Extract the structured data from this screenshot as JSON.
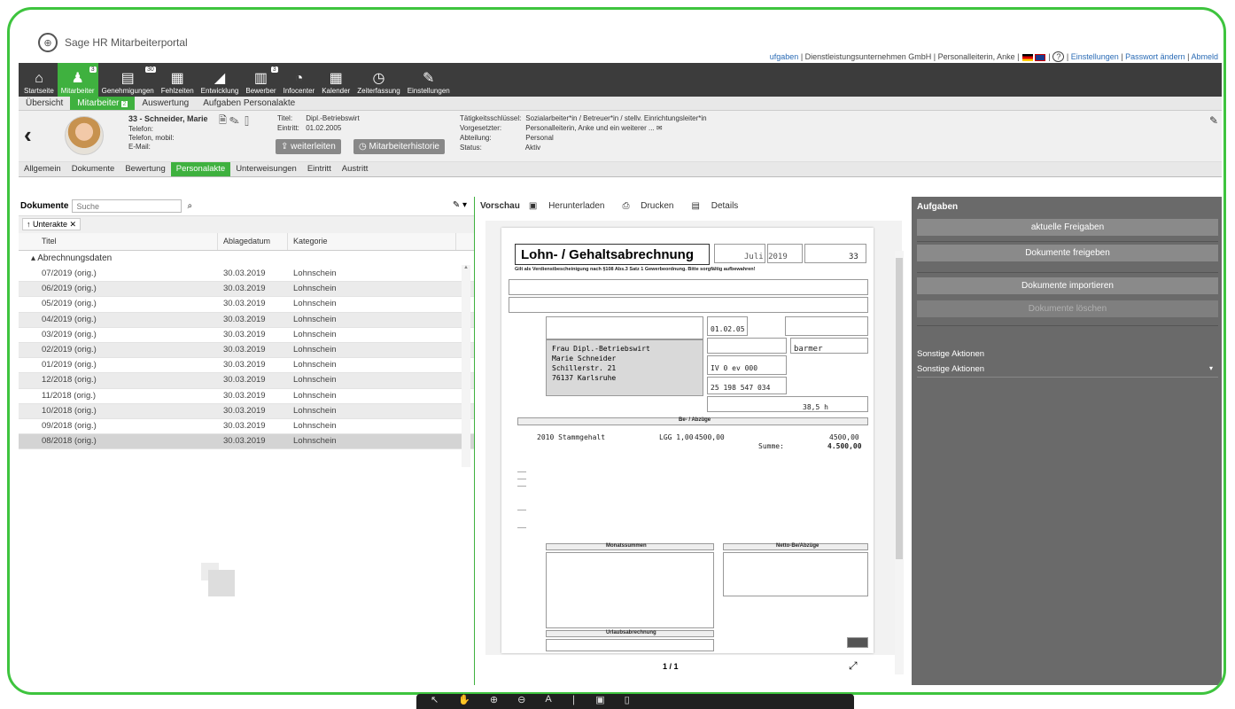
{
  "app": {
    "title": "Sage HR Mitarbeiterportal"
  },
  "toplinks": {
    "aufgaben": "ufgaben",
    "company": "Dienstleistungsunternehmen GmbH",
    "user": "Personalleiterin, Anke",
    "help": "?",
    "settings": "Einstellungen",
    "password": "Passwort ändern",
    "logout": "Abmeld"
  },
  "nav": [
    {
      "label": "Startseite",
      "icon": "home-icon",
      "glyph": "⌂"
    },
    {
      "label": "Mitarbeiter",
      "icon": "person-icon",
      "glyph": "♟",
      "badge": "3",
      "active": true
    },
    {
      "label": "Genehmigungen",
      "icon": "document-icon",
      "glyph": "▤",
      "badge": "30"
    },
    {
      "label": "Fehlzeiten",
      "icon": "calendar-icon",
      "glyph": "▦"
    },
    {
      "label": "Entwicklung",
      "icon": "chart-icon",
      "glyph": "◢"
    },
    {
      "label": "Bewerber",
      "icon": "applicant-icon",
      "glyph": "▥",
      "badge": "3"
    },
    {
      "label": "Infocenter",
      "icon": "pie-icon",
      "glyph": "◔"
    },
    {
      "label": "Kalender",
      "icon": "calendar-icon",
      "glyph": "▦"
    },
    {
      "label": "Zeiterfassung",
      "icon": "clock-icon",
      "glyph": "◷"
    },
    {
      "label": "Einstellungen",
      "icon": "wrench-icon",
      "glyph": "✎"
    }
  ],
  "subtabs": [
    {
      "label": "Übersicht"
    },
    {
      "label": "Mitarbeiter",
      "badge": "2",
      "active": true
    },
    {
      "label": "Auswertung"
    },
    {
      "label": "Aufgaben Personalakte"
    }
  ],
  "profile": {
    "name": "33 - Schneider, Marie",
    "telefon": "Telefon:",
    "telefon_mobil": "Telefon, mobil:",
    "email": "E-Mail:",
    "titel_label": "Titel:",
    "titel_value": "Dipl.-Betriebswirt",
    "eintritt_label": "Eintritt:",
    "eintritt_value": "01.02.2005",
    "btn_weiterleiten": "weiterleiten",
    "btn_historie": "Mitarbeiterhistorie",
    "taetigkeit_label": "Tätigkeitsschlüssel:",
    "taetigkeit_value": "Sozialarbeiter*in / Betreuer*in / stellv. Einrichtungsleiter*in",
    "vorgesetzter_label": "Vorgesetzter:",
    "vorgesetzter_value": "Personalleiterin, Anke und ein weiterer ...",
    "abteilung_label": "Abteilung:",
    "abteilung_value": "Personal",
    "status_label": "Status:",
    "status_value": "Aktiv"
  },
  "tabs2": [
    {
      "label": "Allgemein"
    },
    {
      "label": "Dokumente"
    },
    {
      "label": "Bewertung"
    },
    {
      "label": "Personalakte",
      "active": true
    },
    {
      "label": "Unterweisungen"
    },
    {
      "label": "Eintritt"
    },
    {
      "label": "Austritt"
    }
  ],
  "documents": {
    "label": "Dokumente",
    "search_placeholder": "Suche",
    "chip": "↑ Unterakte ✕",
    "columns": [
      "Titel",
      "Ablagedatum",
      "Kategorie"
    ],
    "group": "Abrechnungsdaten",
    "rows": [
      {
        "titel": "07/2019 (orig.)",
        "datum": "30.03.2019",
        "kategorie": "Lohnschein"
      },
      {
        "titel": "06/2019 (orig.)",
        "datum": "30.03.2019",
        "kategorie": "Lohnschein"
      },
      {
        "titel": "05/2019 (orig.)",
        "datum": "30.03.2019",
        "kategorie": "Lohnschein"
      },
      {
        "titel": "04/2019 (orig.)",
        "datum": "30.03.2019",
        "kategorie": "Lohnschein"
      },
      {
        "titel": "03/2019 (orig.)",
        "datum": "30.03.2019",
        "kategorie": "Lohnschein"
      },
      {
        "titel": "02/2019 (orig.)",
        "datum": "30.03.2019",
        "kategorie": "Lohnschein"
      },
      {
        "titel": "01/2019 (orig.)",
        "datum": "30.03.2019",
        "kategorie": "Lohnschein"
      },
      {
        "titel": "12/2018 (orig.)",
        "datum": "30.03.2019",
        "kategorie": "Lohnschein"
      },
      {
        "titel": "11/2018 (orig.)",
        "datum": "30.03.2019",
        "kategorie": "Lohnschein"
      },
      {
        "titel": "10/2018 (orig.)",
        "datum": "30.03.2019",
        "kategorie": "Lohnschein"
      },
      {
        "titel": "09/2018 (orig.)",
        "datum": "30.03.2019",
        "kategorie": "Lohnschein"
      },
      {
        "titel": "08/2018 (orig.)",
        "datum": "30.03.2019",
        "kategorie": "Lohnschein"
      }
    ]
  },
  "preview": {
    "label": "Vorschau",
    "download": "Herunterladen",
    "print": "Drucken",
    "details": "Details",
    "page": "1 / 1",
    "doc_title": "Lohn- / Gehaltsabrechnung",
    "doc_subtitle": "Gilt als Verdienstbescheinigung nach §108 Abs.3 Satz 1 Gewerbeordnung. Bitte sorgfältig aufbewahren!",
    "doc_month": "Juli 2019",
    "doc_persnr": "33",
    "address": [
      "Frau Dipl.-Betriebswirt",
      "Marie Schneider",
      "Schillerstr. 21",
      "76137 Karlsruhe"
    ],
    "eintritt": "01.02.05",
    "steuer": [
      "IV",
      "0",
      "ev",
      "000"
    ],
    "krankenkasse": "barmer",
    "svnr": "25 198 547 034",
    "stunden": "38,5 h",
    "bezuege_header": "Be- / Abzüge",
    "lohnart": "2010 Stammgehalt",
    "lohn_kennz": "LGG 1,00",
    "lohn_betrag": "4500,00",
    "lohn_total": "4500,00",
    "summe_label": "Summe:",
    "summe": "4.500,00",
    "monatssummen": "Monatssummen",
    "netto_header": "Netto-Be/Abzüge",
    "urlaub_header": "Urlaubsabrechnung"
  },
  "tasks": {
    "title": "Aufgaben",
    "btn_freigaben": "aktuelle Freigaben",
    "btn_freigeben": "Dokumente freigeben",
    "btn_importieren": "Dokumente importieren",
    "btn_loeschen": "Dokumente löschen",
    "sonstige_label": "Sonstige Aktionen",
    "sonstige_select": "Sonstige Aktionen"
  },
  "colors": {
    "accent": "#3fb13f",
    "nav_bg": "#3c3c3c",
    "panel_bg": "#6a6a6a"
  }
}
